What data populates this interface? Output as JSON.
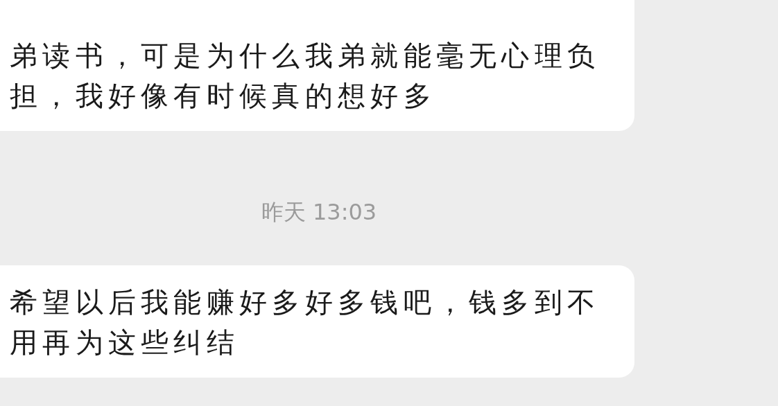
{
  "messages": [
    {
      "kind": "bubble",
      "text": "弟读书，可是为什么我弟就能毫无心理负担，我好像有时候真的想好多"
    },
    {
      "kind": "timestamp",
      "text": "昨天 13:03"
    },
    {
      "kind": "bubble",
      "text": "希望以后我能赚好多好多钱吧，钱多到不用再为这些纠结"
    }
  ]
}
